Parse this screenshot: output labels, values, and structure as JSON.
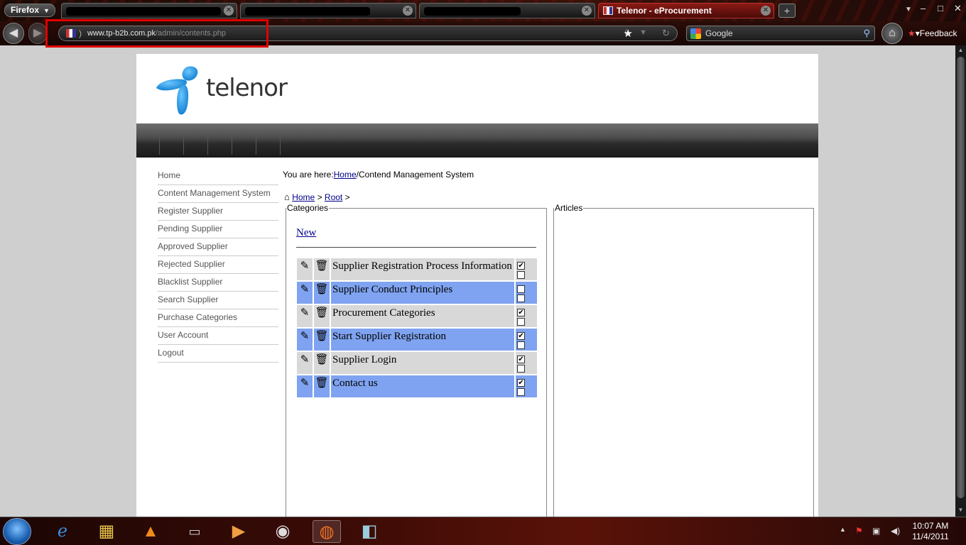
{
  "browser": {
    "menu_label": "Firefox",
    "tabs": [
      {
        "label": "",
        "blacked": true
      },
      {
        "label": "",
        "blacked": true
      },
      {
        "label": "",
        "blacked": true
      },
      {
        "label": "Telenor - eProcurement",
        "active": true
      }
    ],
    "url_host": "www.tp-b2b.com.pk",
    "url_path": "/admin/contents.php",
    "search_engine": "Google",
    "feedback_label": "Feedback"
  },
  "site": {
    "logo_text": "telenor",
    "sidebar": [
      {
        "label": "Home"
      },
      {
        "label": "Content Management System"
      },
      {
        "label": "Register Supplier"
      },
      {
        "label": "Pending Supplier"
      },
      {
        "label": "Approved Supplier"
      },
      {
        "label": "Rejected Supplier"
      },
      {
        "label": "Blacklist Supplier"
      },
      {
        "label": "Search Supplier"
      },
      {
        "label": "Purchase Categories"
      },
      {
        "label": "User Account"
      },
      {
        "label": "Logout"
      }
    ],
    "breadcrumb": {
      "prefix": "You are here:",
      "home": "Home",
      "sep": "/",
      "current": "Contend Management System"
    },
    "tree_path": {
      "home": "Home",
      "sep1": ">",
      "root": "Root",
      "sep2": ">"
    },
    "categories_legend": "Categories",
    "articles_legend": "Articles",
    "new_link": "New",
    "categories": [
      {
        "name": "Supplier Registration Process Information",
        "top_checked": true,
        "bottom_checked": false
      },
      {
        "name": "Supplier Conduct Principles",
        "top_checked": false,
        "bottom_checked": false
      },
      {
        "name": "Procurement Categories",
        "top_checked": true,
        "bottom_checked": false
      },
      {
        "name": "Start Supplier Registration",
        "top_checked": true,
        "bottom_checked": false
      },
      {
        "name": "Supplier Login",
        "top_checked": true,
        "bottom_checked": false
      },
      {
        "name": "Contact us",
        "top_checked": true,
        "bottom_checked": false
      }
    ],
    "colors": {
      "row_odd": "#d8d8d8",
      "row_even": "#7fa3f0",
      "link": "#00008b",
      "logo_blue": "#1a9ae0"
    }
  },
  "taskbar": {
    "time": "10:07 AM",
    "date": "11/4/2011"
  }
}
